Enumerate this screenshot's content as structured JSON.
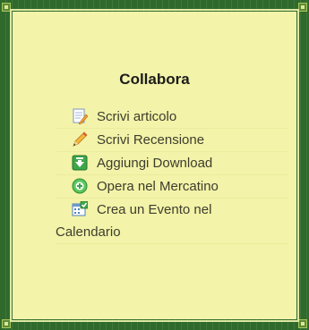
{
  "box": {
    "title": "Collabora"
  },
  "menu": {
    "items": [
      {
        "label": "Scrivi articolo",
        "icon": "document-edit-icon"
      },
      {
        "label": "Scrivi Recensione",
        "icon": "pencil-icon"
      },
      {
        "label": "Aggiungi Download",
        "icon": "download-icon"
      },
      {
        "label": "Opera nel Mercatino",
        "icon": "add-circle-icon"
      },
      {
        "label": "Crea un Evento nel",
        "label_line2": "Calendario",
        "icon": "calendar-icon"
      }
    ]
  },
  "colors": {
    "panel_background": "#f3f3a9",
    "frame": "#2f6a2c",
    "text": "#3d3d2e"
  }
}
